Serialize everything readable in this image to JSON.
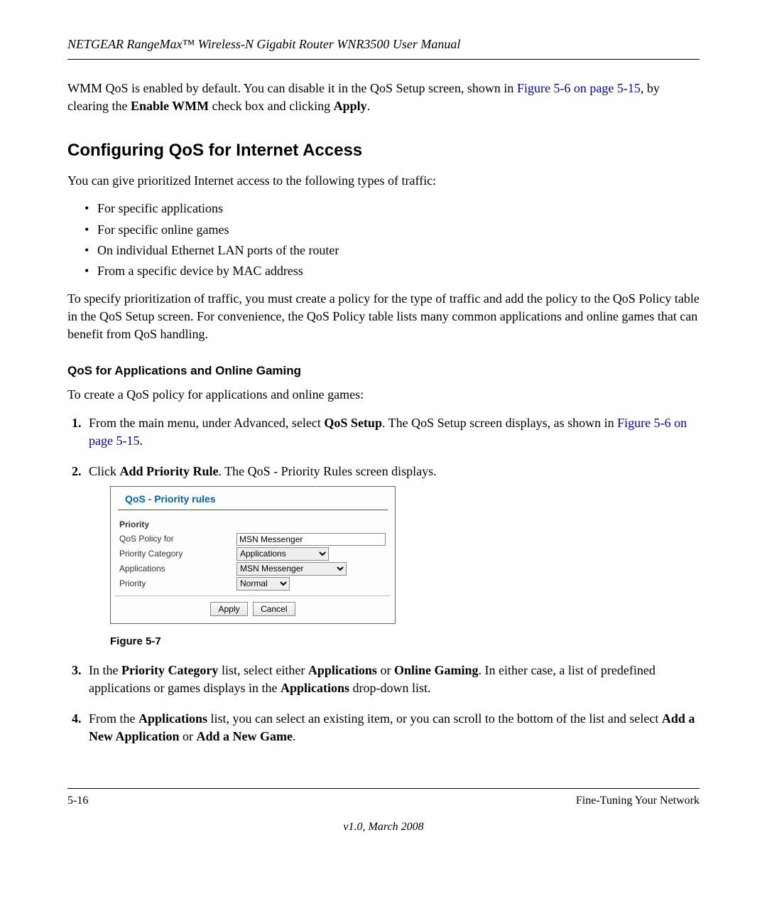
{
  "header": {
    "title": "NETGEAR RangeMax™ Wireless-N Gigabit Router WNR3500 User Manual"
  },
  "intro": {
    "p1_a": "WMM QoS is enabled by default. You can disable it in the QoS Setup screen, shown in ",
    "p1_link": "Figure 5-6 on page 5-15",
    "p1_b": ", by clearing the ",
    "p1_bold": "Enable WMM",
    "p1_c": " check box and clicking ",
    "p1_bold2": "Apply",
    "p1_d": "."
  },
  "h2": "Configuring QoS for Internet Access",
  "p2": "You can give prioritized Internet access to the following types of traffic:",
  "bullets": [
    "For specific applications",
    "For specific online games",
    "On individual Ethernet LAN ports of the router",
    "From a specific device by MAC address"
  ],
  "p3": "To specify prioritization of traffic, you must create a policy for the type of traffic and add the policy to the QoS Policy table in the QoS Setup screen. For convenience, the QoS Policy table lists many common applications and online games that can benefit from QoS handling.",
  "h3": "QoS for Applications and Online Gaming",
  "p4": "To create a QoS policy for applications and online games:",
  "steps": {
    "s1_a": "From the main menu, under Advanced, select ",
    "s1_bold": "QoS Setup",
    "s1_b": ". The QoS Setup screen displays, as shown in ",
    "s1_link": "Figure 5-6 on page 5-15",
    "s1_c": ".",
    "s2_a": "Click ",
    "s2_bold": "Add Priority Rule",
    "s2_b": ". The QoS - Priority Rules screen displays.",
    "s3_a": "In the ",
    "s3_b1": "Priority Category",
    "s3_c": " list, select either ",
    "s3_b2": "Applications",
    "s3_d": " or ",
    "s3_b3": "Online Gaming",
    "s3_e": ". In either case, a list of predefined applications or games displays in the ",
    "s3_b4": "Applications",
    "s3_f": " drop-down list.",
    "s4_a": "From the ",
    "s4_b1": "Applications",
    "s4_b": " list, you can select an existing item, or you can scroll to the bottom of the list and select ",
    "s4_b2": "Add a New Application",
    "s4_c": " or ",
    "s4_b3": "Add a New Game",
    "s4_d": "."
  },
  "panel": {
    "title": "QoS - Priority rules",
    "section": "Priority",
    "rows": {
      "policy_label": "QoS Policy for",
      "policy_value": "MSN Messenger",
      "category_label": "Priority Category",
      "category_value": "Applications",
      "app_label": "Applications",
      "app_value": "MSN Messenger",
      "priority_label": "Priority",
      "priority_value": "Normal"
    },
    "buttons": {
      "apply": "Apply",
      "cancel": "Cancel"
    }
  },
  "fig_caption": "Figure 5-7",
  "footer": {
    "page": "5-16",
    "section": "Fine-Tuning Your Network",
    "version": "v1.0, March 2008"
  }
}
